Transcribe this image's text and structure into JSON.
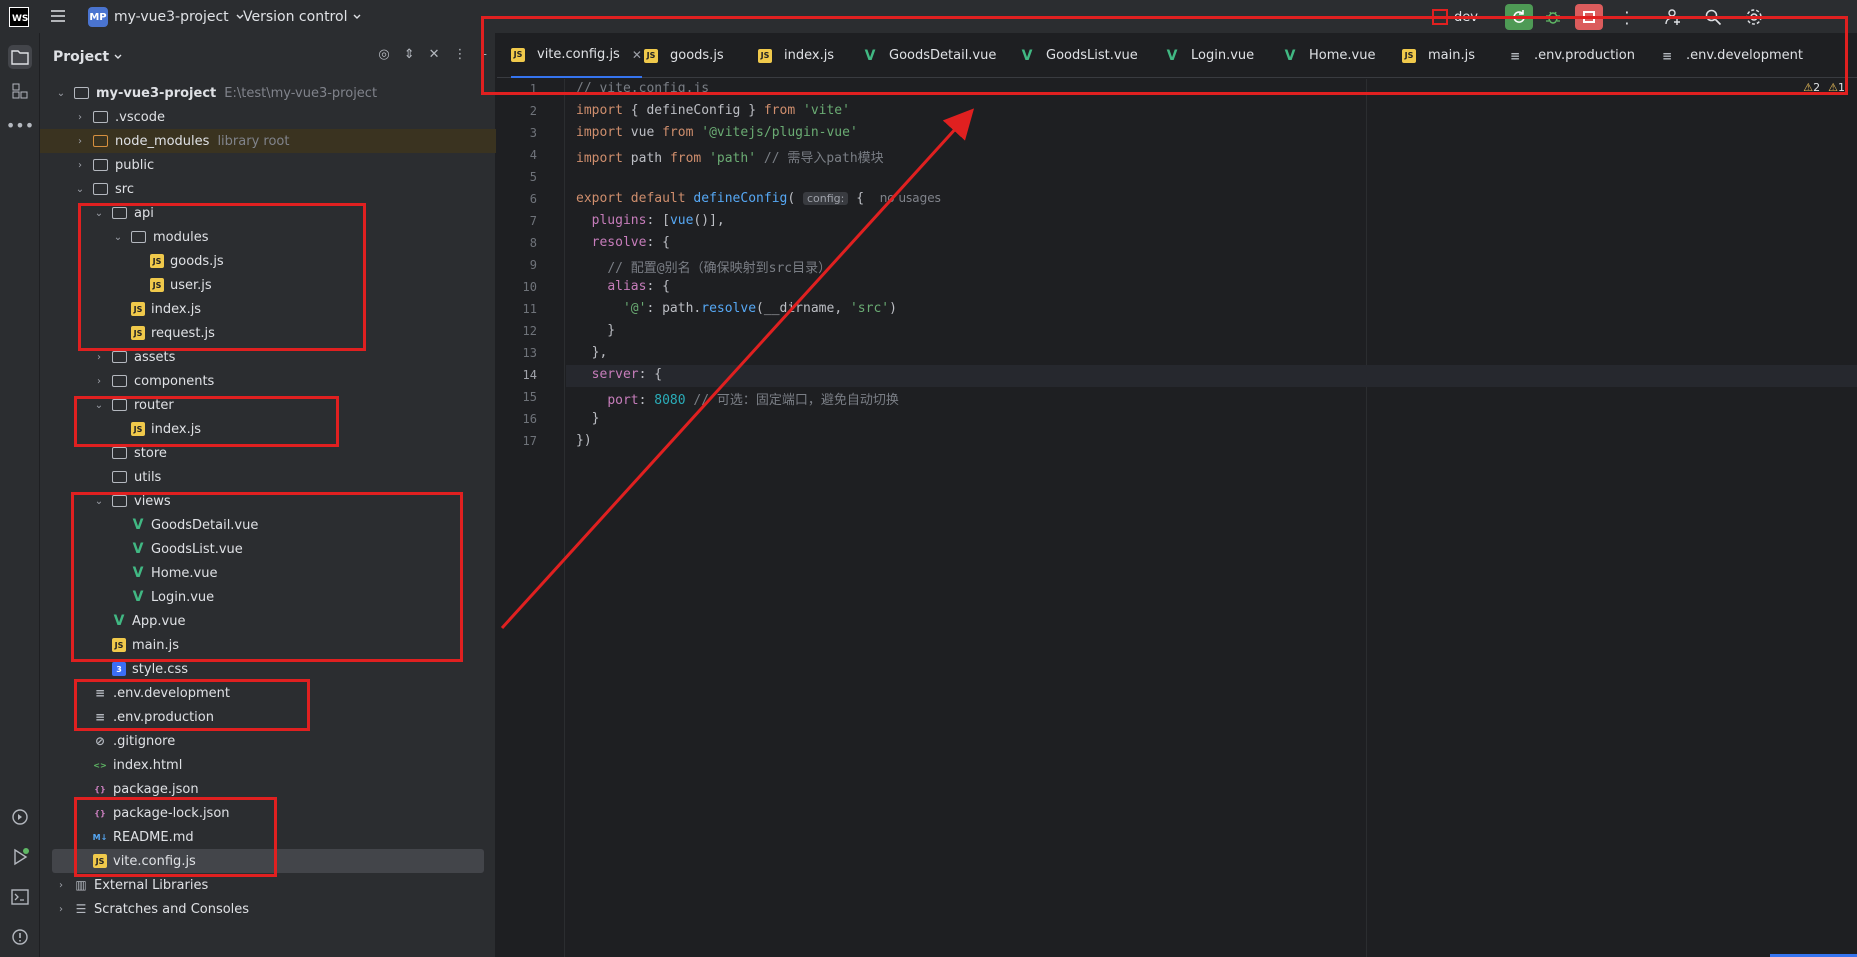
{
  "titlebar": {
    "app_logo": "WS",
    "project_badge": "MP",
    "project_name": "my-vue3-project",
    "version_control": "Version control",
    "run_config": "dev"
  },
  "project_panel": {
    "title": "Project",
    "tree": [
      {
        "label": "my-vue3-project",
        "extra": "E:\\test\\my-vue3-project",
        "icon": "folder-icon",
        "expanded": true
      },
      {
        "label": ".vscode",
        "icon": "folder-icon",
        "expanded": false
      },
      {
        "label": "node_modules",
        "extra": "library root",
        "icon": "folder-icon",
        "expanded": false
      },
      {
        "label": "public",
        "icon": "folder-icon",
        "expanded": false
      },
      {
        "label": "src",
        "icon": "folder-icon",
        "expanded": true
      },
      {
        "label": "api",
        "icon": "folder-icon",
        "expanded": true
      },
      {
        "label": "modules",
        "icon": "folder-icon",
        "expanded": true
      },
      {
        "label": "goods.js",
        "icon": "js-file-icon"
      },
      {
        "label": "user.js",
        "icon": "js-file-icon"
      },
      {
        "label": "index.js",
        "icon": "js-file-icon"
      },
      {
        "label": "request.js",
        "icon": "js-file-icon"
      },
      {
        "label": "assets",
        "icon": "folder-icon",
        "expanded": false
      },
      {
        "label": "components",
        "icon": "folder-icon",
        "expanded": false
      },
      {
        "label": "router",
        "icon": "folder-icon",
        "expanded": true
      },
      {
        "label": "index.js",
        "icon": "js-file-icon"
      },
      {
        "label": "store",
        "icon": "folder-icon"
      },
      {
        "label": "utils",
        "icon": "folder-icon"
      },
      {
        "label": "views",
        "icon": "folder-icon",
        "expanded": true
      },
      {
        "label": "GoodsDetail.vue",
        "icon": "vue-file-icon"
      },
      {
        "label": "GoodsList.vue",
        "icon": "vue-file-icon"
      },
      {
        "label": "Home.vue",
        "icon": "vue-file-icon"
      },
      {
        "label": "Login.vue",
        "icon": "vue-file-icon"
      },
      {
        "label": "App.vue",
        "icon": "vue-file-icon"
      },
      {
        "label": "main.js",
        "icon": "js-file-icon"
      },
      {
        "label": "style.css",
        "icon": "css-file-icon"
      },
      {
        "label": ".env.development",
        "icon": "text-file-icon"
      },
      {
        "label": ".env.production",
        "icon": "text-file-icon"
      },
      {
        "label": ".gitignore",
        "icon": "ignore-file-icon"
      },
      {
        "label": "index.html",
        "icon": "html-file-icon"
      },
      {
        "label": "package.json",
        "icon": "json-file-icon"
      },
      {
        "label": "package-lock.json",
        "icon": "json-file-icon"
      },
      {
        "label": "README.md",
        "icon": "markdown-file-icon",
        "icon_text": "M↓"
      },
      {
        "label": "vite.config.js",
        "icon": "js-file-icon",
        "selected": true
      },
      {
        "label": "External Libraries",
        "icon": "library-icon",
        "expanded": false
      },
      {
        "label": "Scratches and Consoles",
        "icon": "scratches-icon",
        "expanded": false
      }
    ]
  },
  "editor": {
    "tabs": [
      {
        "label": "vite.config.js",
        "icon": "js-file-icon",
        "active": true
      },
      {
        "label": "goods.js",
        "icon": "js-file-icon"
      },
      {
        "label": "index.js",
        "icon": "js-file-icon"
      },
      {
        "label": "GoodsDetail.vue",
        "icon": "vue-file-icon"
      },
      {
        "label": "GoodsList.vue",
        "icon": "vue-file-icon"
      },
      {
        "label": "Login.vue",
        "icon": "vue-file-icon"
      },
      {
        "label": "Home.vue",
        "icon": "vue-file-icon"
      },
      {
        "label": "main.js",
        "icon": "js-file-icon"
      },
      {
        "label": ".env.production",
        "icon": "text-file-icon"
      },
      {
        "label": ".env.development",
        "icon": "text-file-icon"
      }
    ],
    "inspections": {
      "warnings": "2",
      "weak_warnings": "1"
    },
    "current_line": 14,
    "lines": [
      "// vite.config.js",
      "import { defineConfig } from 'vite'",
      "import vue from '@vitejs/plugin-vue'",
      "import path from 'path' // 需导入path模块",
      "",
      "export default defineConfig( config: {  no usages",
      "  plugins: [vue()],",
      "  resolve: {",
      "    // 配置@别名（确保映射到src目录）",
      "    alias: {",
      "      '@': path.resolve(__dirname, 'src')",
      "    }",
      "  },",
      "  server: {",
      "    port: 8080 // 可选：固定端口，避免自动切换",
      "  }",
      "})"
    ],
    "hint_text": "config:",
    "no_usages": "no usages"
  },
  "colors": {
    "annotation_red": "#e02020",
    "accent": "#3574f0"
  }
}
